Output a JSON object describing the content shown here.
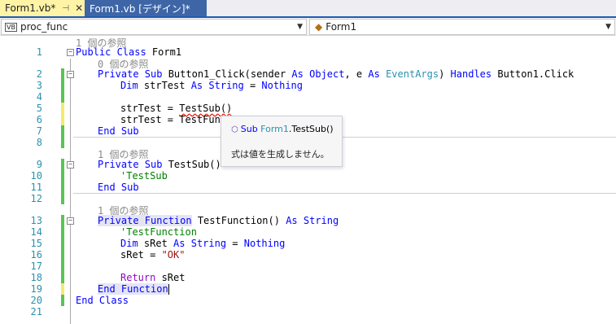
{
  "tabs": [
    {
      "label": "Form1.vb*",
      "pin": "⊣",
      "close": "✕"
    },
    {
      "label": "Form1.vb [デザイン]*"
    }
  ],
  "nav": {
    "left_badge": "VB",
    "left_label": "proc_func",
    "right_label": "Form1"
  },
  "lens": {
    "l1": "1 個の参照",
    "l2": "0 個の参照",
    "l9": "1 個の参照",
    "l13": "1 個の参照"
  },
  "code": {
    "l1": {
      "kw": "Public Class",
      "rest": " Form1"
    },
    "l2": {
      "kw": "Private Sub",
      "name": " Button1_Click(sender",
      "as1": " As",
      "t1": " Object",
      "comma": ", e",
      "as2": " As",
      "t2": " EventArgs",
      "paren": ")",
      "handles": " Handles",
      "tail": " Button1.Click"
    },
    "l3": {
      "kw": "Dim",
      "var": " strTest",
      "as": " As",
      "t": " String",
      "eq": " =",
      "nothing": " Nothing"
    },
    "l5": {
      "a": "strTest = ",
      "b": "TestSub()"
    },
    "l6": {
      "a": "strTest = TestFunc"
    },
    "l7": {
      "kw": "End Sub"
    },
    "l9": {
      "kw": "Private Sub",
      "rest": " TestSub()"
    },
    "l10": {
      "cm": "'TestSub"
    },
    "l11": {
      "kw": "End Sub"
    },
    "l13": {
      "kw": "Private Function",
      "name": " TestFunction()",
      "as": " As",
      "t": " String"
    },
    "l14": {
      "cm": "'TestFunction"
    },
    "l15": {
      "kw": "Dim",
      "var": " sRet",
      "as": " As",
      "t": " String",
      "eq": " =",
      "nothing": " Nothing"
    },
    "l16": {
      "a": "sRet = ",
      "s": "\"OK\""
    },
    "l18": {
      "kw": "Return",
      "rest": " sRet"
    },
    "l19": {
      "kw": "End Function"
    },
    "l20": {
      "kw": "End Class"
    }
  },
  "line_numbers": [
    "1",
    "2",
    "3",
    "4",
    "5",
    "6",
    "7",
    "8",
    "9",
    "10",
    "11",
    "12",
    "13",
    "14",
    "15",
    "16",
    "17",
    "18",
    "19",
    "20",
    "21"
  ],
  "tooltip": {
    "kw": "Sub",
    "cls": "Form1",
    "member": ".TestSub()",
    "desc": "式は値を生成しません。"
  },
  "colors": {
    "keyword": "#0000ff",
    "type": "#2b91af",
    "comment": "#008000",
    "string": "#a31515",
    "control": "#8f08c4",
    "change_saved": "#57c553",
    "change_unsaved": "#f5ea6b",
    "active_tab": "#fff3a6",
    "inactive_tab": "#3e66a7"
  }
}
